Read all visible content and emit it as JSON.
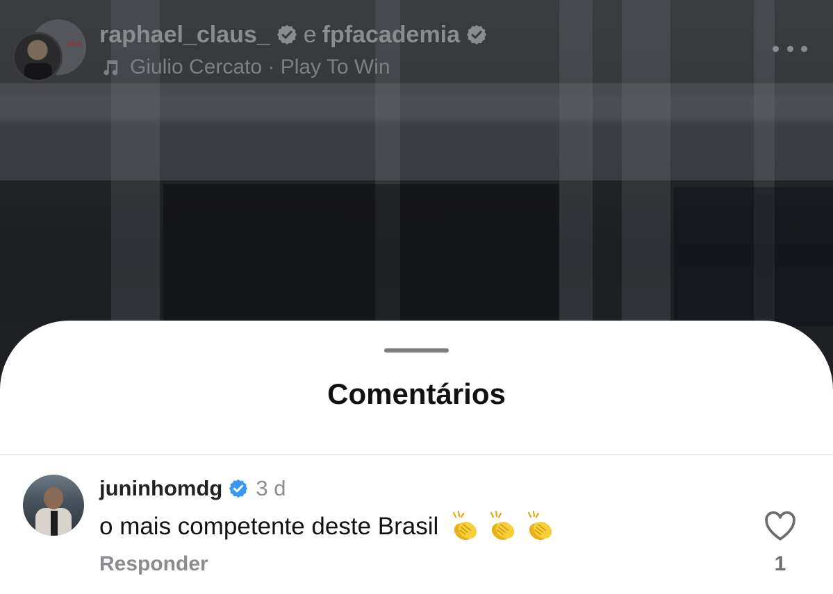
{
  "header": {
    "account_1": "raphael_claus_",
    "joiner": "e",
    "account_2": "fpfacademia",
    "back_avatar_label": "MIA",
    "music": "Giulio Cercato · Play To Win"
  },
  "sheet": {
    "title": "Comentários"
  },
  "comments": [
    {
      "username": "juninhomdg",
      "verified": true,
      "time": "3 d",
      "text": "o mais competente deste Brasil",
      "emoji": "clapping-hands x3",
      "reply_label": "Responder",
      "like_count": "1"
    }
  ],
  "colors": {
    "verified_blue": "#3897f0",
    "clap_yellow": "#f5c518",
    "muted_text": "#8a8c90"
  }
}
